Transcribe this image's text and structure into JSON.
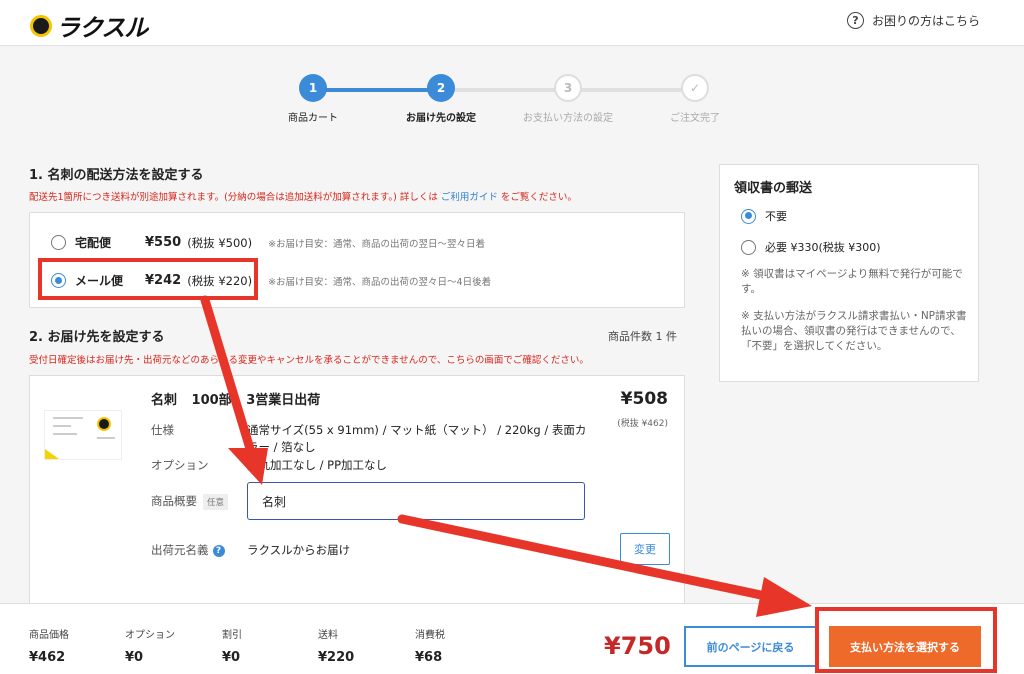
{
  "header": {
    "logo_text": "ラクスル",
    "help_label": "お困りの方はこちら"
  },
  "steps": [
    {
      "num": "1",
      "label": "商品カート",
      "state": "done"
    },
    {
      "num": "2",
      "label": "お届け先の設定",
      "state": "active"
    },
    {
      "num": "3",
      "label": "お支払い方法の設定",
      "state": "todo"
    },
    {
      "num": "✓",
      "label": "ご注文完了",
      "state": "todo"
    }
  ],
  "section1": {
    "title": "1. 名刺の配送方法を設定する",
    "notice_before": "配送先1箇所につき送料が別途加算されます。(分納の場合は追加送料が加算されます。) 詳しくは",
    "notice_link": "ご利用ガイド",
    "notice_after": "をご覧ください。",
    "options": [
      {
        "name": "宅配便",
        "price": "¥550",
        "tax": "(税抜 ¥500)",
        "eta": "※お届け目安：通常、商品の出荷の翌日〜翌々日着",
        "selected": false
      },
      {
        "name": "メール便",
        "price": "¥242",
        "tax": "(税抜 ¥220)",
        "eta": "※お届け目安：通常、商品の出荷の翌々日〜4日後着",
        "selected": true
      }
    ]
  },
  "section2": {
    "title": "2. お届け先を設定する",
    "count_label": "商品件数 1 件",
    "notice": "受付日確定後はお届け先・出荷元などのあらゆる変更やキャンセルを承ることができませんので、こちらの画面でご確認ください。"
  },
  "product": {
    "name": "名刺",
    "qty": "100部",
    "lead": "3営業日出荷",
    "price": "¥508",
    "tax": "(税抜 ¥462)",
    "spec_label": "仕様",
    "spec_value": "通常サイズ(55 x 91mm) / マット紙（マット） / 220kg / 表面カラー / 箔なし",
    "option_label": "オプション",
    "option_value": "角丸加工なし / PP加工なし",
    "summary_label": "商品概要",
    "optional_tag": "任意",
    "summary_value": "名刺",
    "sender_label": "出荷元名義",
    "sender_value": "ラクスルからお届け",
    "change_label": "変更"
  },
  "receipt": {
    "title": "領収書の郵送",
    "options": [
      {
        "label": "不要",
        "selected": true
      },
      {
        "label": "必要 ¥330(税抜 ¥300)",
        "selected": false
      }
    ],
    "note1": "※ 領収書はマイページより無料で発行が可能です。",
    "note2": "※ 支払い方法がラクスル請求書払い・NP請求書払いの場合、領収書の発行はできませんので、「不要」を選択してください。"
  },
  "footer": {
    "items": [
      {
        "label": "商品価格",
        "value": "¥462"
      },
      {
        "label": "オプション",
        "value": "¥0"
      },
      {
        "label": "割引",
        "value": "¥0"
      },
      {
        "label": "送料",
        "value": "¥220"
      },
      {
        "label": "消費税",
        "value": "¥68"
      }
    ],
    "total": "¥750",
    "back_label": "前のページに戻る",
    "pay_label": "支払い方法を選択する"
  },
  "colors": {
    "accent": "#3b8bd8",
    "alert": "#d8261c",
    "cta": "#ee6a2a",
    "annotation": "#e8352a"
  }
}
